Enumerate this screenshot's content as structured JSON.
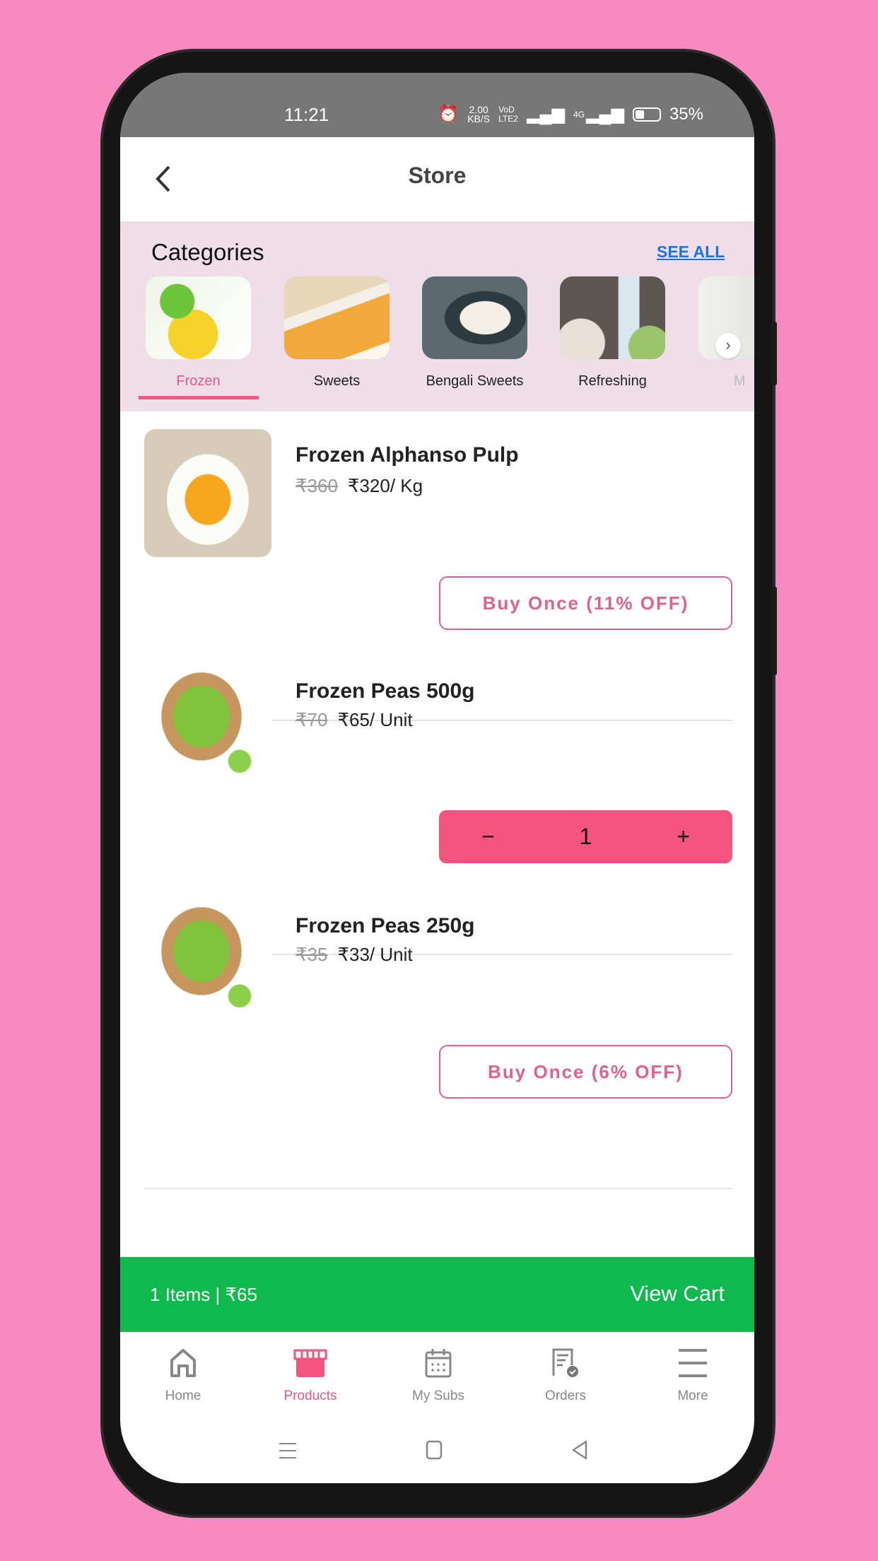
{
  "status_bar": {
    "time": "11:21",
    "speed": "2.00",
    "speed_unit": "KB/S",
    "volte": "VoD LTE2",
    "network": "4G",
    "battery": "35%"
  },
  "header": {
    "title": "Store",
    "back_icon": "chevron-left-icon"
  },
  "categories": {
    "title": "Categories",
    "see_all": "SEE ALL",
    "items": [
      {
        "label": "Frozen",
        "active": true
      },
      {
        "label": "Sweets"
      },
      {
        "label": "Bengali Sweets"
      },
      {
        "label": "Refreshing"
      },
      {
        "label": "M"
      }
    ]
  },
  "products": [
    {
      "name": "Frozen Alphanso Pulp",
      "old_price": "₹360",
      "price": "₹320/ Kg",
      "action": "Buy Once (11% OFF)"
    },
    {
      "name": "Frozen Peas 500g",
      "old_price": "₹70",
      "price": "₹65/ Unit",
      "quantity": "1",
      "minus": "−",
      "plus": "+"
    },
    {
      "name": "Frozen Peas 250g",
      "old_price": "₹35",
      "price": "₹33/ Unit",
      "action": "Buy Once (6% OFF)"
    }
  ],
  "cart": {
    "summary": "1 Items | ₹65",
    "view_cart": "View Cart"
  },
  "bottom_nav": [
    {
      "label": "Home"
    },
    {
      "label": "Products",
      "active": true
    },
    {
      "label": "My Subs"
    },
    {
      "label": "Orders"
    },
    {
      "label": "More"
    }
  ],
  "colors": {
    "accent": "#f4547d",
    "cart_bar": "#10b94d",
    "category_bg": "#efdde7",
    "link": "#1a73e8"
  }
}
